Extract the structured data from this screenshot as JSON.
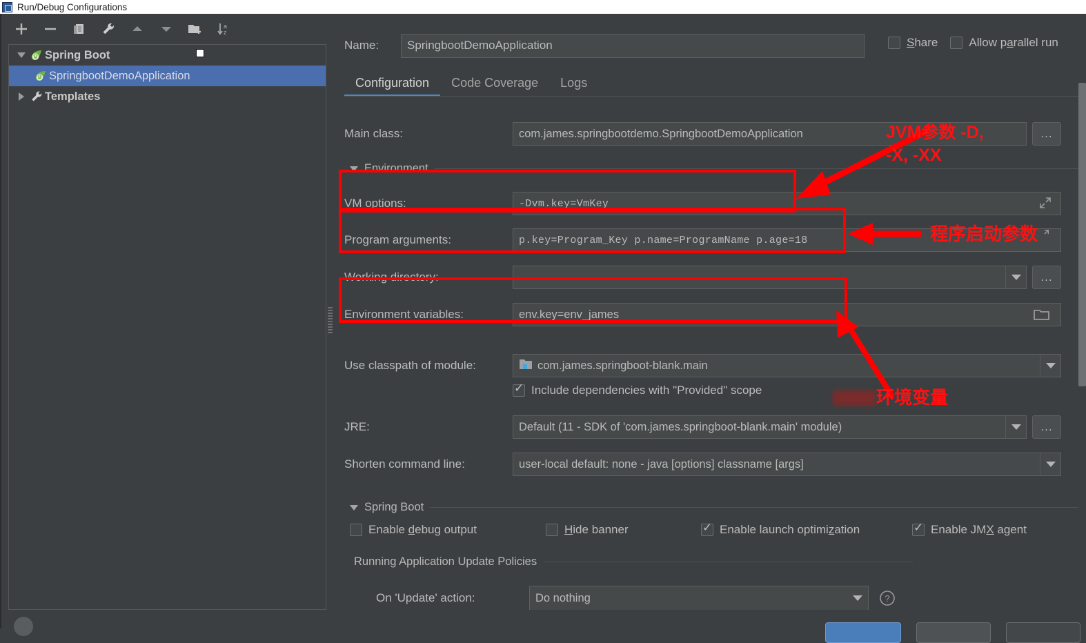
{
  "window": {
    "title": "Run/Debug Configurations",
    "icon": "app-window-icon"
  },
  "toolbar": {
    "buttons": [
      {
        "name": "add-configuration-button",
        "icon": "plus-icon",
        "label": "+"
      },
      {
        "name": "remove-configuration-button",
        "icon": "minus-icon",
        "label": "−"
      },
      {
        "name": "copy-configuration-button",
        "icon": "copy-icon",
        "label": "Copy"
      },
      {
        "name": "edit-templates-button",
        "icon": "wrench-icon",
        "label": "Edit Templates"
      },
      {
        "name": "move-up-button",
        "icon": "arrow-up-icon",
        "label": "Move Up"
      },
      {
        "name": "move-down-button",
        "icon": "arrow-down-icon",
        "label": "Move Down"
      },
      {
        "name": "new-folder-button",
        "icon": "folder-add-icon",
        "label": "New Folder"
      },
      {
        "name": "sort-button",
        "icon": "sort-az-icon",
        "label": "Sort Configurations"
      }
    ]
  },
  "tree": {
    "nodes": [
      {
        "label": "Spring Boot",
        "icon": "spring-boot-icon",
        "expanded": true,
        "selected": false,
        "child": false
      },
      {
        "label": "SpringbootDemoApplication",
        "icon": "spring-boot-icon",
        "expanded": false,
        "selected": true,
        "child": true
      },
      {
        "label": "Templates",
        "icon": "wrench-icon",
        "expanded": false,
        "selected": false,
        "child": false
      }
    ]
  },
  "form": {
    "name_label": "Name:",
    "name_value": "SpringbootDemoApplication",
    "share_label": "Share",
    "share_mnemonic": "S",
    "share_rest": "hare",
    "parallel_label": "Allow parallel run",
    "parallel_pre": "Allow p",
    "parallel_mnemonic": "a",
    "parallel_post": "rallel run",
    "tabs": [
      {
        "label": "Configuration",
        "active": true
      },
      {
        "label": "Code Coverage",
        "active": false
      },
      {
        "label": "Logs",
        "active": false
      }
    ],
    "main_class_label": "Main class:",
    "main_class_value": "com.james.springbootdemo.SpringbootDemoApplication",
    "browse_label": "...",
    "environment_section": "Environment",
    "vm_options_label": "VM options:",
    "vm_options_value": "-Dvm.key=VmKey",
    "program_arguments_label": "Program arguments:",
    "program_arguments_value": "p.key=Program_Key p.name=ProgramName p.age=18",
    "working_directory_label": "Working directory:",
    "working_directory_value": "",
    "environment_variables_label": "Environment variables:",
    "environment_variables_value": "env.key=env_james",
    "classpath_label": "Use classpath of module:",
    "classpath_value": "com.james.springboot-blank.main",
    "include_provided_label": "Include dependencies with \"Provided\" scope",
    "include_provided_checked": true,
    "jre_label": "JRE:",
    "jre_value": "Default (11 - SDK of 'com.james.springboot-blank.main' module)",
    "shorten_label": "Shorten command line:",
    "shorten_value": "user-local default: none - java [options] classname [args]",
    "springboot_section": "Spring Boot",
    "springboot_checkboxes": [
      {
        "pre": "Enable ",
        "mnemonic": "d",
        "post": "ebug output",
        "checked": false,
        "name": "enable-debug-output-checkbox"
      },
      {
        "pre": "",
        "mnemonic": "H",
        "post": "ide banner",
        "checked": false,
        "name": "hide-banner-checkbox"
      },
      {
        "pre": "Enable launch optimi",
        "mnemonic": "z",
        "post": "ation",
        "checked": true,
        "name": "enable-launch-optimization-checkbox"
      },
      {
        "pre": "Enable JM",
        "mnemonic": "X",
        "post": " agent",
        "checked": true,
        "name": "enable-jmx-agent-checkbox"
      }
    ],
    "update_policies_section": "Running Application Update Policies",
    "on_update_label": "On 'Update' action:",
    "on_update_value": "Do nothing",
    "help_icon": "question-mark-icon"
  },
  "annotations": [
    {
      "name": "jvm-args-annotation",
      "line1": "JVM参数  -D,",
      "line2": "-X, -XX"
    },
    {
      "name": "program-args-annotation",
      "text": "程序启动参数"
    },
    {
      "name": "env-vars-annotation",
      "text": "环境变量"
    }
  ],
  "buttons": {
    "ok": "",
    "cancel": "",
    "apply": ""
  },
  "colors": {
    "accent": "#4a88c7",
    "selection": "#4b6eaf",
    "annotation": "#ff0000",
    "panel": "#3c3f41",
    "field": "#45494a"
  }
}
